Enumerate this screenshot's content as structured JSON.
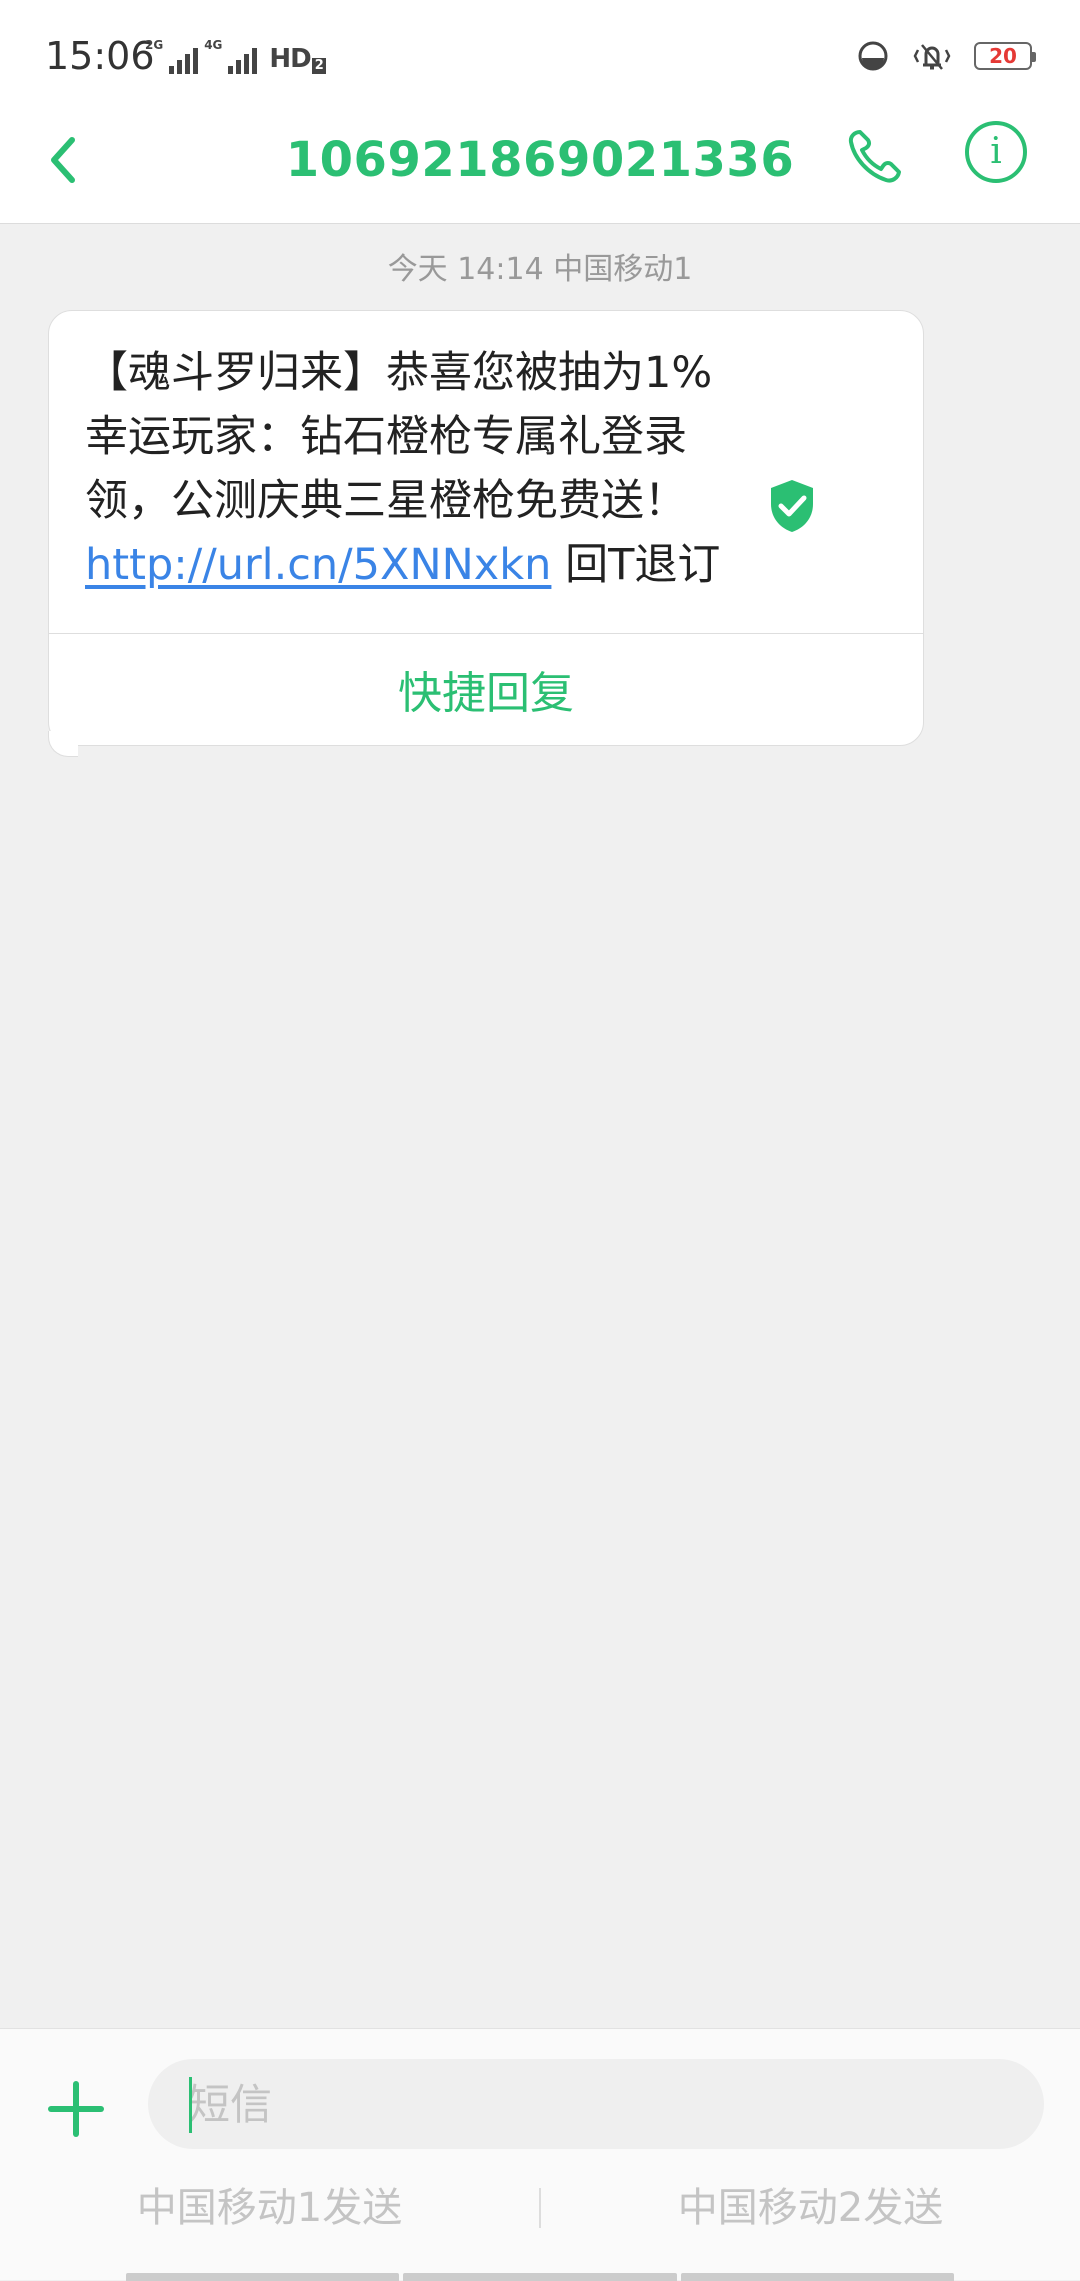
{
  "status_bar": {
    "time": "15:06",
    "network_1": "2G",
    "network_2": "4G",
    "hd_label": "HD",
    "hd_sub": "2",
    "battery": "20",
    "icons": [
      "data-saver-icon",
      "vibrate-icon",
      "battery-icon"
    ]
  },
  "header": {
    "title": "106921869021336",
    "back_icon": "chevron-left-icon",
    "call_icon": "phone-icon",
    "info_icon": "info-icon",
    "info_glyph": "i"
  },
  "conversation": {
    "timestamp": "今天 14:14  中国移动1",
    "message": {
      "lines": [
        "【魂斗罗归来】恭喜您被抽为1%",
        "幸运玩家：钻石橙枪专属礼登录",
        "领，公测庆典三星橙枪免费送！"
      ],
      "link": "http://url.cn/5XNNxkn",
      "suffix": " 回T退订",
      "verified_icon": "verified-shield-icon"
    },
    "quick_reply": "快捷回复"
  },
  "composer": {
    "placeholder": "短信",
    "value": "",
    "send_sim1": "中国移动1发送",
    "send_sim2": "中国移动2发送"
  },
  "colors": {
    "accent": "#2bbf73",
    "link": "#3a84e6",
    "battery_low": "#e53935",
    "background": "#f0f0f0"
  }
}
